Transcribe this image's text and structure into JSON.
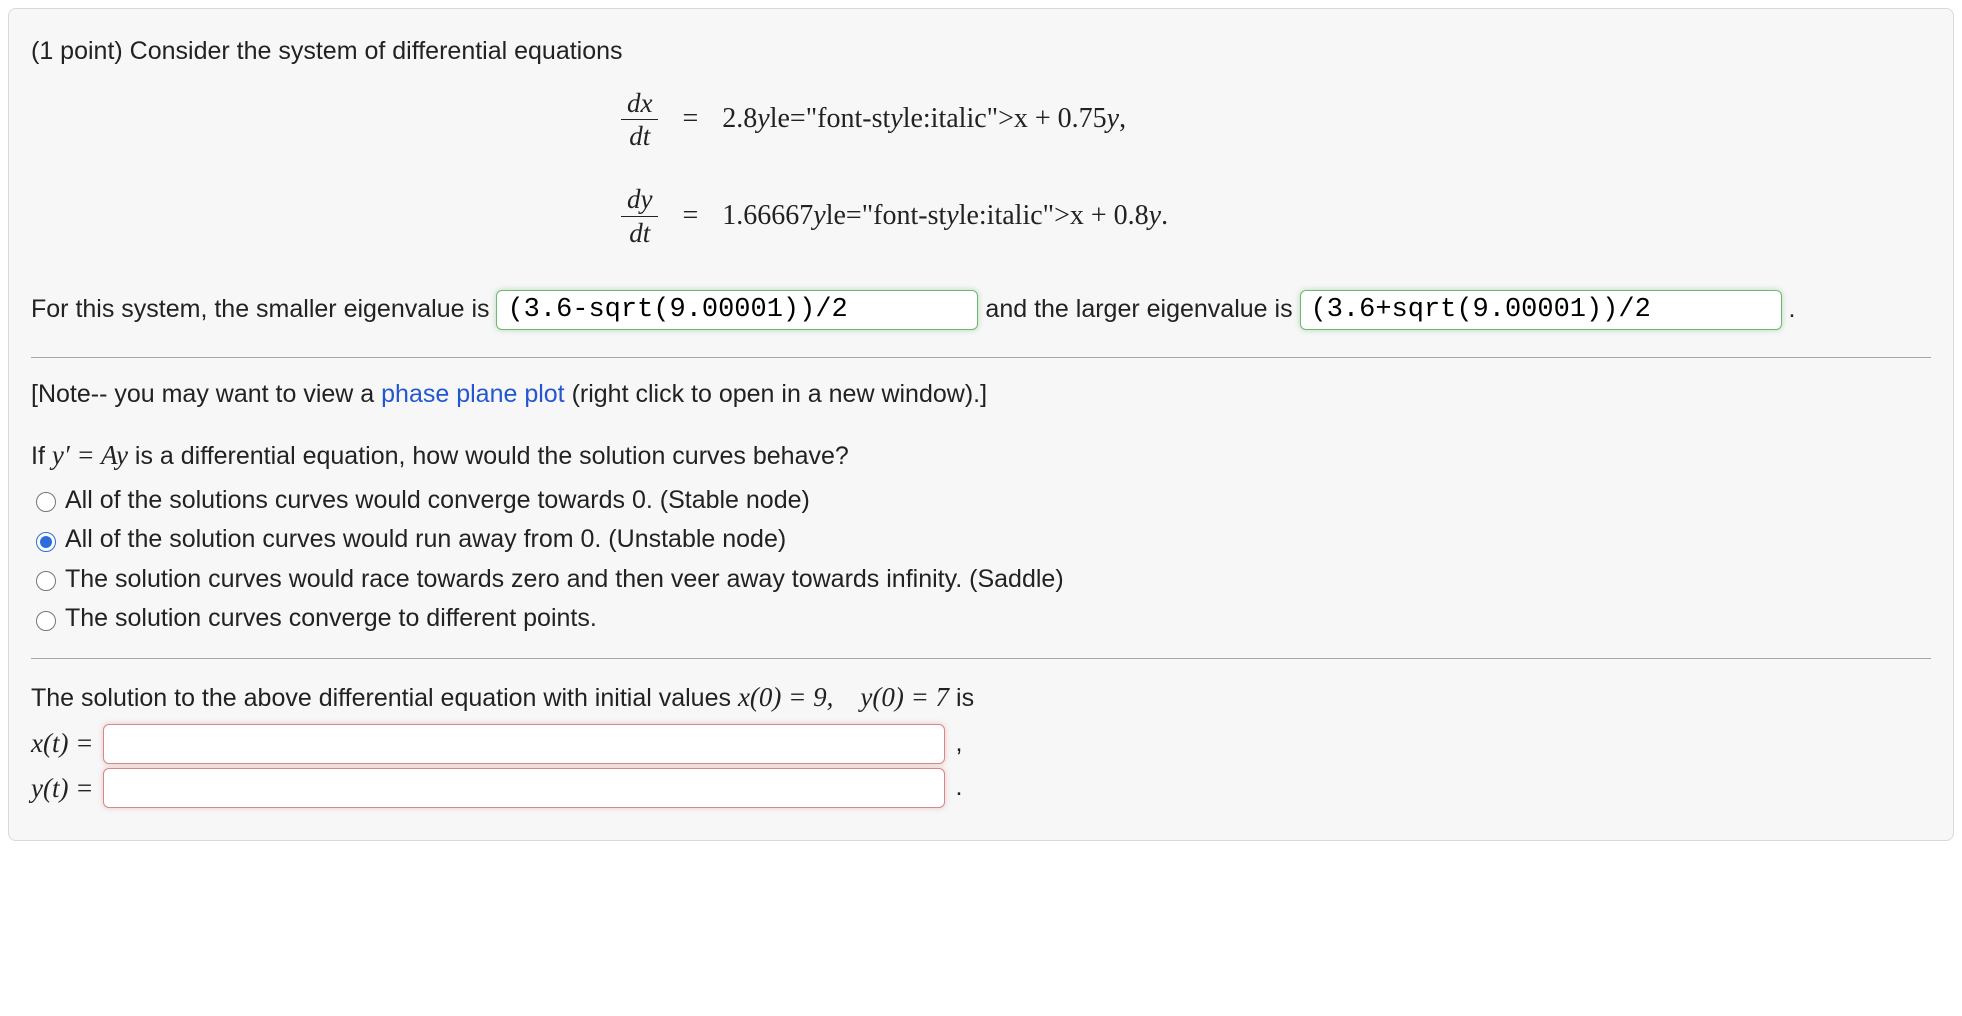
{
  "points_label": "(1 point)",
  "prompt_intro": "Consider the system of differential equations",
  "eq1": {
    "lhs_num": "dx",
    "lhs_den": "dt",
    "rhs": "2.8x + 0.75y,"
  },
  "eq2": {
    "lhs_num": "dy",
    "lhs_den": "dt",
    "rhs": "1.66667x + 0.8y."
  },
  "eigen_text_before": "For this system, the smaller eigenvalue is ",
  "eigen_text_between": " and the larger eigenvalue is ",
  "eigen_small_value": "(3.6-sqrt(9.00001))/2",
  "eigen_large_value": "(3.6+sqrt(9.00001))/2",
  "period": " .",
  "note_open": "[Note-- you may want to view a ",
  "note_link": "phase plane plot",
  "note_close": " (right click to open in a new window).]",
  "behavior_q_pre": "If ",
  "behavior_q_math": "y′ = Ay",
  "behavior_q_post": " is a differential equation, how would the solution curves behave?",
  "options": [
    "All of the solutions curves would converge towards 0. (Stable node)",
    "All of the solution curves would run away from 0. (Unstable node)",
    "The solution curves would race towards zero and then veer away towards infinity. (Saddle)",
    "The solution curves converge to different points."
  ],
  "selected_index": 1,
  "sol_prompt_pre": "The solution to the above differential equation with initial values ",
  "sol_prompt_math": "x(0) = 9, y(0) = 7",
  "sol_prompt_post": " is",
  "xt_label": "x(t) = ",
  "yt_label": "y(t) = ",
  "xt_value": "",
  "yt_value": "",
  "x_trail": " ,",
  "y_trail": " ."
}
